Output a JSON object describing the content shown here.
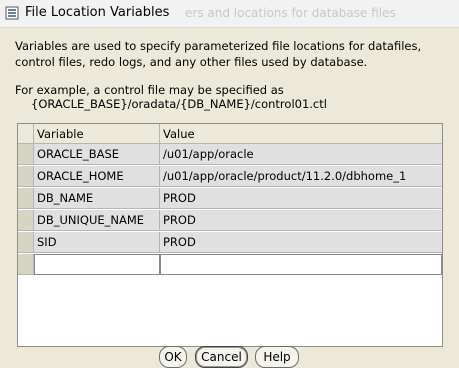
{
  "window": {
    "title": "File Location Variables",
    "background_text": "ers and locations for database files"
  },
  "dialog": {
    "description": "Variables are used to specify parameterized file locations for datafiles, control files, redo logs, and any other files used by database.",
    "example_line1": "For example, a control file may be specified as",
    "example_line2": "{ORACLE_BASE}/oradata/{DB_NAME}/control01.ctl"
  },
  "table": {
    "columns": [
      "Variable",
      "Value"
    ],
    "rows": [
      {
        "variable": "ORACLE_BASE",
        "value": "/u01/app/oracle"
      },
      {
        "variable": "ORACLE_HOME",
        "value": "/u01/app/oracle/product/11.2.0/dbhome_1"
      },
      {
        "variable": "DB_NAME",
        "value": "PROD"
      },
      {
        "variable": "DB_UNIQUE_NAME",
        "value": "PROD"
      },
      {
        "variable": "SID",
        "value": "PROD"
      },
      {
        "variable": "",
        "value": ""
      }
    ]
  },
  "buttons": {
    "ok": "OK",
    "cancel": "Cancel",
    "help": "Help"
  },
  "icons": {
    "app": "java-app-icon"
  }
}
